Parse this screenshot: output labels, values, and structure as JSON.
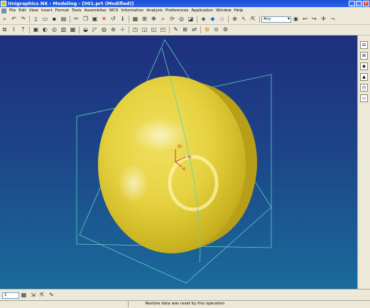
{
  "window": {
    "title": "Unigraphics NX - Modeling - [001.prt (Modified)]"
  },
  "menu": [
    "File",
    "Edit",
    "View",
    "Insert",
    "Format",
    "Tools",
    "Assemblies",
    "WCS",
    "Information",
    "Analysis",
    "Preferences",
    "Application",
    "Window",
    "Help"
  ],
  "toolbar": {
    "filter_value": "Any"
  },
  "wcs": {
    "x_label": "XC",
    "y_label": "YC",
    "z_label": "ZC"
  },
  "bottom_toolbar": {
    "layer_value": "1"
  },
  "status": {
    "message": "Restore data was reset by this operation"
  },
  "colors": {
    "viewport_top": "#1e2f7e",
    "viewport_bottom": "#1a6b9b",
    "solid": "#e8d84a",
    "datum_plane": "#5fd0c0"
  }
}
